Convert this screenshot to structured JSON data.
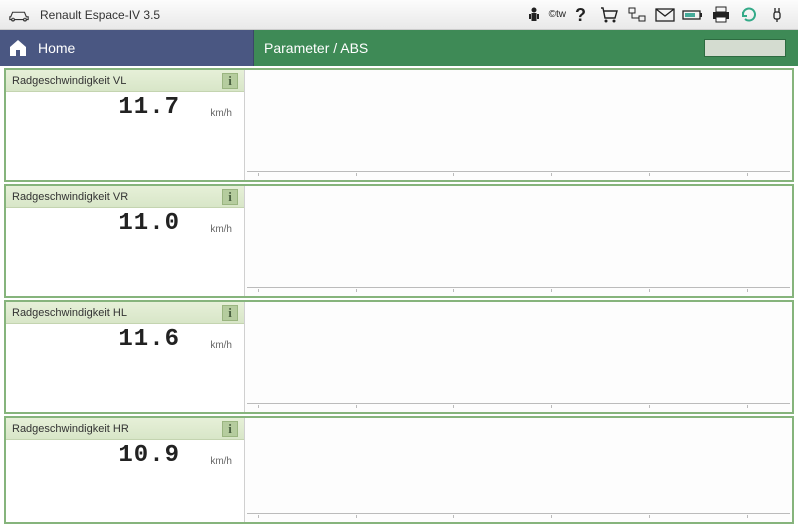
{
  "titlebar": {
    "vehicle": "Renault Espace-IV 3.5"
  },
  "toolbar": {
    "otw_label": "©tw"
  },
  "nav": {
    "home_label": "Home",
    "breadcrumb": "Parameter / ABS"
  },
  "parameters": [
    {
      "name": "Radgeschwindigkeit VL",
      "value": "11.7",
      "unit": "km/h"
    },
    {
      "name": "Radgeschwindigkeit VR",
      "value": "11.0",
      "unit": "km/h"
    },
    {
      "name": "Radgeschwindigkeit HL",
      "value": "11.6",
      "unit": "km/h"
    },
    {
      "name": "Radgeschwindigkeit HR",
      "value": "10.9",
      "unit": "km/h"
    }
  ]
}
